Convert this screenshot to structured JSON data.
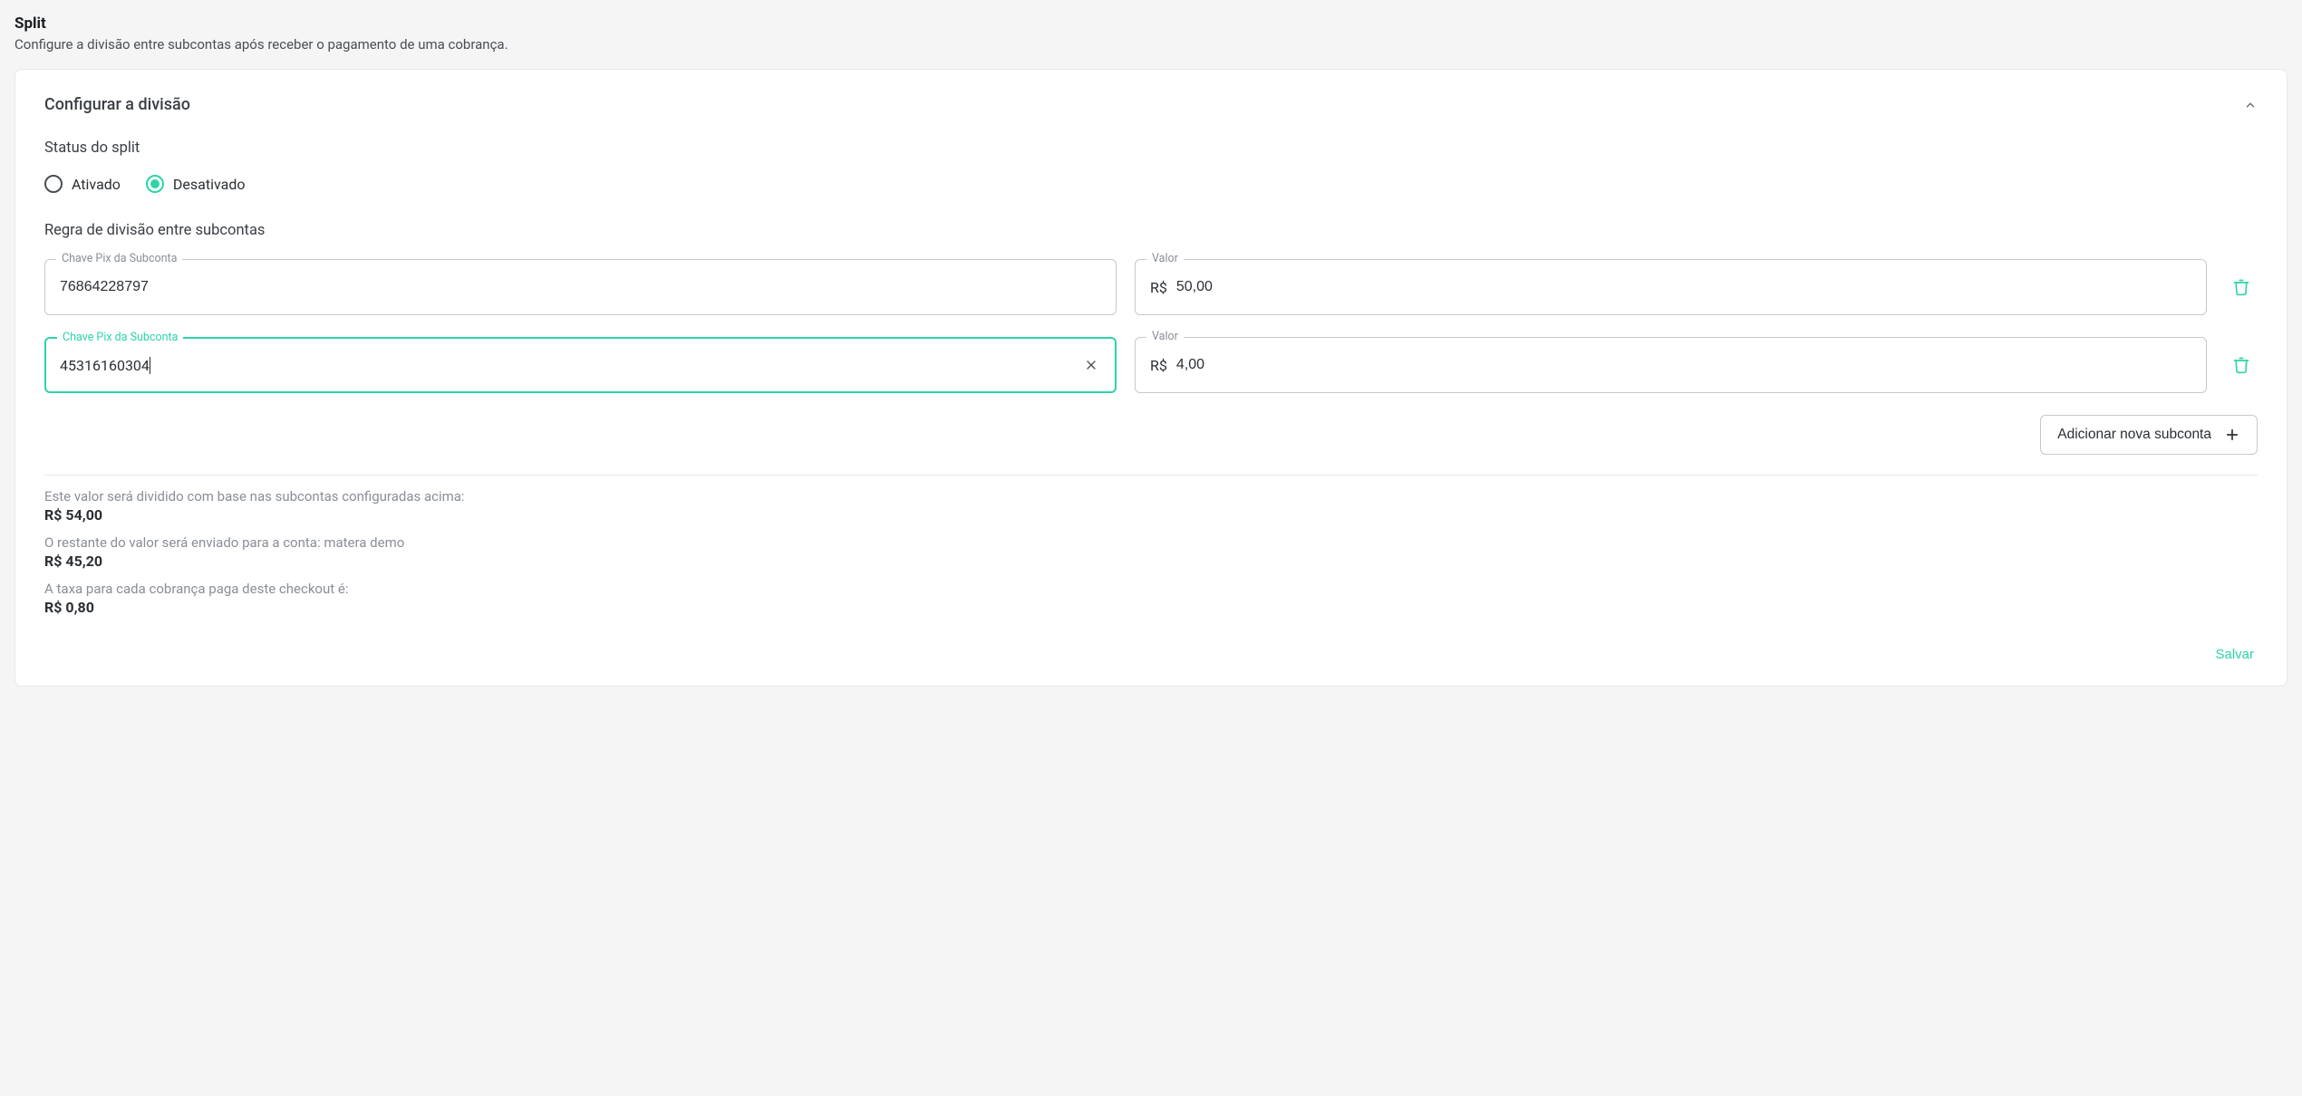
{
  "header": {
    "title": "Split",
    "subtitle": "Configure a divisão entre subcontas após receber o pagamento de uma cobrança."
  },
  "card": {
    "title": "Configurar a divisão"
  },
  "status": {
    "label": "Status do split",
    "ativado": "Ativado",
    "desativado": "Desativado"
  },
  "rule": {
    "label": "Regra de divisão entre subcontas",
    "pix_label": "Chave Pix da Subconta",
    "valor_label": "Valor",
    "currency": "R$"
  },
  "rows": [
    {
      "pix": "76864228797",
      "valor": "50,00"
    },
    {
      "pix": "45316160304",
      "valor": "4,00"
    }
  ],
  "add_label": "Adicionar nova subconta",
  "summary": {
    "divided_label": "Este valor será dividido com base nas subcontas configuradas acima:",
    "divided_value": "R$ 54,00",
    "remaining_label": "O restante do valor será enviado para a conta: matera demo",
    "remaining_value": "R$ 45,20",
    "fee_label": "A taxa para cada cobrança paga deste checkout é:",
    "fee_value": "R$ 0,80"
  },
  "save_label": "Salvar"
}
